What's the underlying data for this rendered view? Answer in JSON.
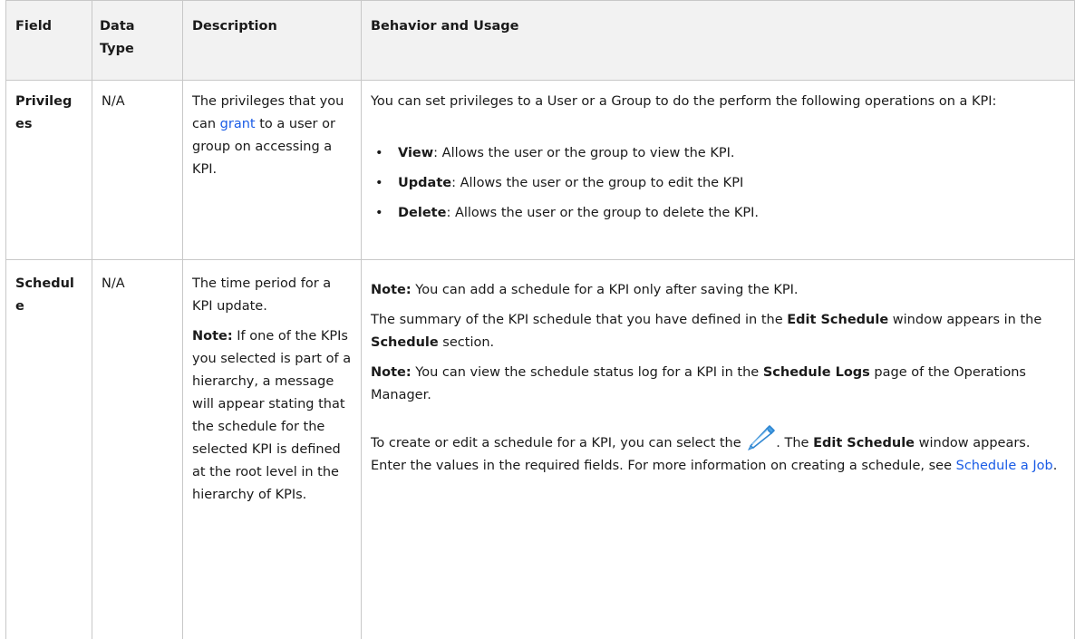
{
  "columns": [
    "Field",
    "Data Type",
    "Description",
    "Behavior and Usage"
  ],
  "data_type_line1": "Data",
  "data_type_line2": "Type",
  "rows": [
    {
      "field_line1": "Privileg",
      "field_line2": "es",
      "data_type": "N/A",
      "description": {
        "before_link": "The privileges that you can ",
        "link": "grant",
        "after_link": " to a user or group on accessing a KPI."
      },
      "behavior": {
        "intro": "You can set privileges to a User or a Group to do the perform the following operations on a KPI:",
        "bullets": [
          {
            "term": "View",
            "text": ": Allows the user or the group to view the KPI."
          },
          {
            "term": "Update",
            "text": ": Allows the user or the group to edit the KPI"
          },
          {
            "term": "Delete",
            "text": ": Allows the user or the group to delete the KPI."
          }
        ]
      }
    },
    {
      "field_line1": "Schedul",
      "field_line2": "e",
      "data_type": "N/A",
      "description": {
        "text": "The time period for a KPI update.",
        "note_label": "Note:",
        "note_text": " If one of the KPIs you selected is part of a hierarchy, a message will appear stating that the schedule for the selected KPI is defined at the root level in the hierarchy of KPIs."
      },
      "behavior": {
        "note1_label": "Note:",
        "note1_text": " You can add a schedule for a KPI only after saving the KPI.",
        "p2_a": "The summary of the KPI schedule that you have defined in the ",
        "p2_b": "Edit Schedule",
        "p2_c": " window appears in the ",
        "p2_d": "Schedule",
        "p2_e": " section.",
        "note2_label": "Note:",
        "note2_a": " You can view the schedule status log for a KPI in the ",
        "note2_b": "Schedule Logs",
        "note2_c": " page of the Operations Manager.",
        "p4_a": "To create or edit a schedule for a KPI, you can select the ",
        "p4_icon": "pencil-icon",
        "p4_b": ". The ",
        "p4_c": "Edit Schedule",
        "p4_d": " window appears. Enter the values in the required fields. For more information on creating a schedule, see ",
        "p4_link": "Schedule a Job",
        "p4_e": "."
      }
    }
  ],
  "colors": {
    "border": "#c8c8c8",
    "header_bg": "#f2f2f2",
    "link": "#1a5ce6",
    "pencil": "#4aa3e8"
  }
}
